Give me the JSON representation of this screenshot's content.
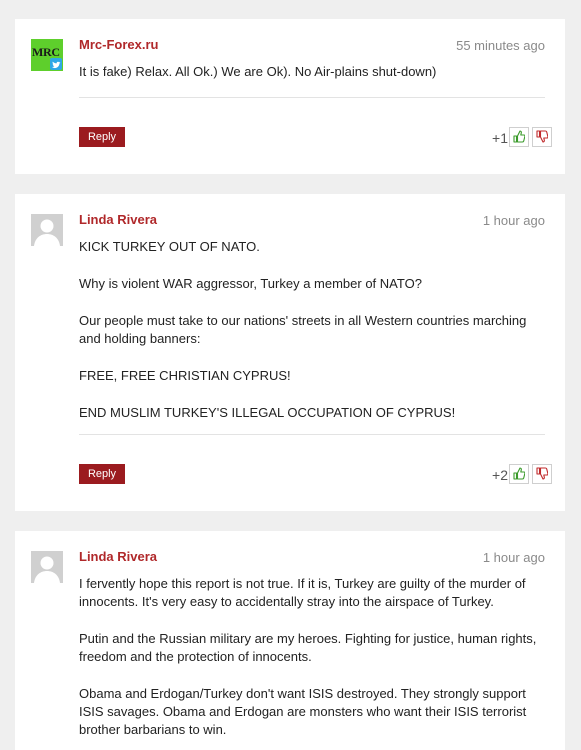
{
  "comments": [
    {
      "author": "Mrc-Forex.ru",
      "avatar_text": "MRC",
      "avatar_badge_icon": "twitter-icon",
      "time": "55 minutes ago",
      "paragraphs": [
        "It is fake) Relax. All Ok.) We are Ok). No Air-plains shut-down)"
      ],
      "reply_label": "Reply",
      "score": "+1"
    },
    {
      "author": "Linda Rivera",
      "time": "1 hour ago",
      "paragraphs": [
        "KICK TURKEY OUT OF NATO.",
        "Why is violent WAR aggressor, Turkey a member of NATO?",
        "Our people must take to our nations' streets in all Western countries marching and holding banners:",
        "FREE, FREE CHRISTIAN CYPRUS!",
        "END MUSLIM TURKEY'S ILLEGAL OCCUPATION OF CYPRUS!"
      ],
      "reply_label": "Reply",
      "score": "+2"
    },
    {
      "author": "Linda Rivera",
      "time": "1 hour ago",
      "paragraphs": [
        "I fervently hope this report is not true. If it is, Turkey are guilty of the murder of innocents. It's very easy to accidentally stray into the airspace of Turkey.",
        "Putin and the Russian military are my heroes. Fighting for justice, human rights, freedom and the protection of innocents.",
        "Obama and Erdogan/Turkey don't want ISIS destroyed. They strongly support ISIS savages. Obama and Erdogan are monsters who want their ISIS terrorist brother barbarians to win."
      ]
    }
  ],
  "colors": {
    "author": "#b0282a",
    "reply_button": "#9b1b1f",
    "thumb_up": "#3a9a2a",
    "thumb_down": "#c0282a",
    "background": "#efefef"
  }
}
